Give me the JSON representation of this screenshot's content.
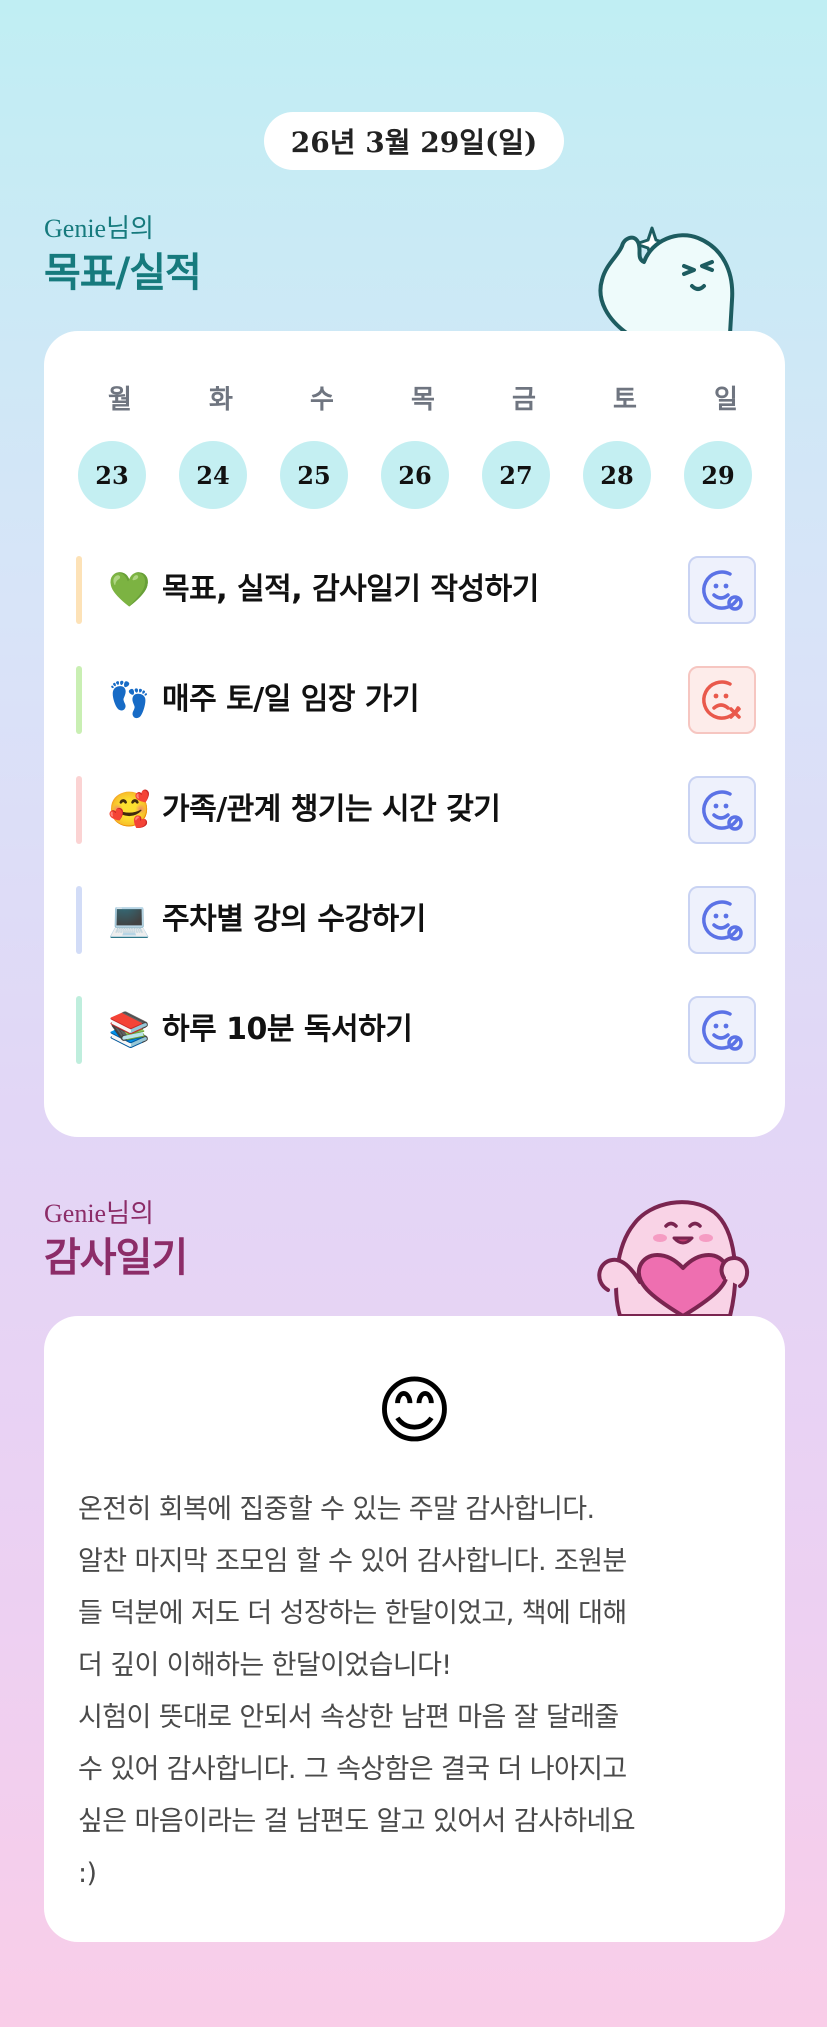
{
  "date": "26년 3월 29일(일)",
  "goals_section": {
    "subtitle": "Genie님의",
    "title": "목표/실적"
  },
  "week": {
    "weekdays": [
      "월",
      "화",
      "수",
      "목",
      "금",
      "토",
      "일"
    ],
    "days": [
      "23",
      "24",
      "25",
      "26",
      "27",
      "28",
      "29"
    ]
  },
  "goals": [
    {
      "emoji": "💚",
      "text": "목표, 실적, 감사일기 작성하기",
      "bar_color": "#fde2b7",
      "status": "done",
      "status_icon": "smile-check-icon"
    },
    {
      "emoji": "👣",
      "text": "매주 토/일 임장 가기",
      "bar_color": "#c9efb3",
      "status": "missed",
      "status_icon": "sad-x-icon"
    },
    {
      "emoji": "🥰",
      "text": "가족/관계 챙기는 시간 갖기",
      "bar_color": "#fbd3d3",
      "status": "done",
      "status_icon": "smile-check-icon"
    },
    {
      "emoji": "💻",
      "text": "주차별 강의 수강하기",
      "bar_color": "#d2dcf7",
      "status": "done",
      "status_icon": "smile-check-icon"
    },
    {
      "emoji": "📚",
      "text": "하루 10분 독서하기",
      "bar_color": "#bfeedd",
      "status": "done",
      "status_icon": "smile-check-icon"
    }
  ],
  "diary_section": {
    "subtitle": "Genie님의",
    "title": "감사일기"
  },
  "diary": {
    "mood_emoji": "😊",
    "text": "온전히 회복에 집중할 수 있는 주말 감사합니다.\n알찬 마지막 조모임 할 수 있어 감사합니다. 조원분\n들 덕분에 저도 더 성장하는 한달이었고, 책에 대해\n더 깊이 이해하는 한달이었습니다!\n시험이 뜻대로 안되서 속상한 남편 마음 잘 달래줄\n수 있어 감사합니다. 그 속상함은 결국 더 나아지고\n싶은 마음이라는 걸 남편도 알고 있어서 감사하네요\n:)"
  },
  "colors": {
    "teal_title": "#167a7d",
    "plum_title": "#8c2c68",
    "day_circle": "#c4eff2",
    "status_ok": "#5b72e6",
    "status_fail": "#e9594c"
  }
}
